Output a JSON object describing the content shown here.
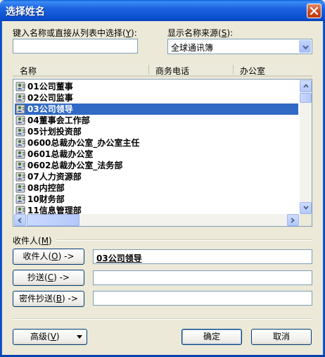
{
  "window": {
    "title": "选择姓名"
  },
  "search": {
    "label_pre": "键入名称或直接从列表中选择(",
    "label_key": "Y",
    "label_post": "):",
    "value": ""
  },
  "source": {
    "label_pre": "显示名称来源(",
    "label_key": "S",
    "label_post": "):",
    "selected": "全球通讯簿"
  },
  "list": {
    "columns": [
      "名称",
      "商务电话",
      "办公室"
    ],
    "items": [
      {
        "label": "01公司董事",
        "selected": false
      },
      {
        "label": "02公司监事",
        "selected": false
      },
      {
        "label": "03公司领导",
        "selected": true
      },
      {
        "label": "04董事会工作部",
        "selected": false
      },
      {
        "label": "05计划投资部",
        "selected": false
      },
      {
        "label": "0600总裁办公室_办公室主任",
        "selected": false
      },
      {
        "label": "0601总裁办公室",
        "selected": false
      },
      {
        "label": "0602总裁办公室_法务部",
        "selected": false
      },
      {
        "label": "07人力资源部",
        "selected": false
      },
      {
        "label": "08内控部",
        "selected": false
      },
      {
        "label": "10财务部",
        "selected": false
      },
      {
        "label": "11信息管理部",
        "selected": false
      }
    ]
  },
  "recipients": {
    "section_pre": "收件人(",
    "section_key": "M",
    "section_post": ")",
    "to_button_pre": "收件人(",
    "to_button_key": "O",
    "to_button_post": ") ->",
    "to_value": "03公司领导",
    "cc_button_pre": "抄送(",
    "cc_button_key": "C",
    "cc_button_post": ") ->",
    "cc_value": "",
    "bcc_button_pre": "密件抄送(",
    "bcc_button_key": "B",
    "bcc_button_post": ") ->",
    "bcc_value": ""
  },
  "footer": {
    "advanced_pre": "高级(",
    "advanced_key": "V",
    "advanced_post": ")",
    "ok_label": "确定",
    "cancel_label": "取消"
  },
  "colors": {
    "titlebar": "#0a4fcf",
    "selection": "#316ac5",
    "dialog_bg": "#ece9d8"
  },
  "icons": [
    "close-icon",
    "contact-card-icon",
    "scroll-up-icon",
    "scroll-down-icon",
    "scroll-left-icon",
    "scroll-right-icon",
    "chevron-down-icon"
  ]
}
